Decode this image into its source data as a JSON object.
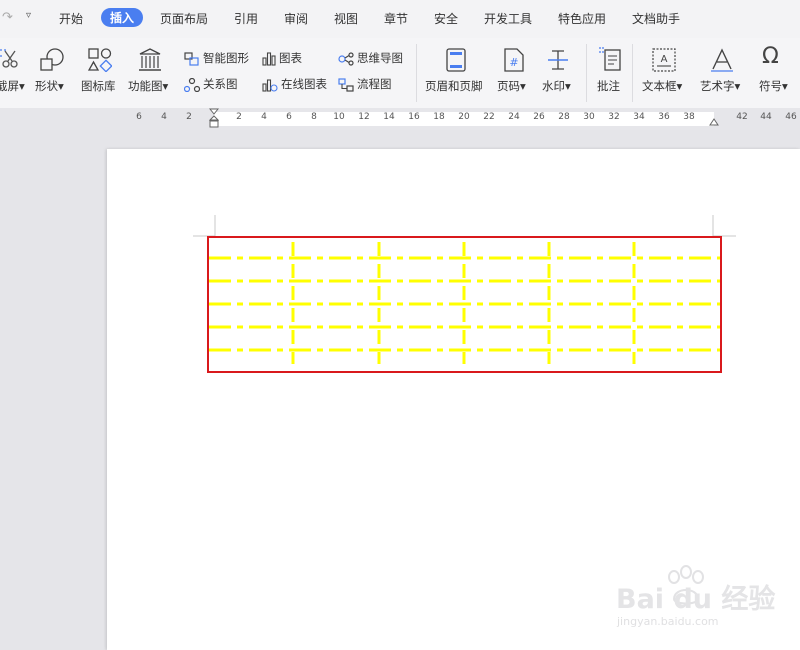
{
  "menu": {
    "items": [
      "开始",
      "插入",
      "页面布局",
      "引用",
      "审阅",
      "视图",
      "章节",
      "安全",
      "开发工具",
      "特色应用",
      "文档助手"
    ],
    "active_index": 1
  },
  "toolbar": {
    "screenshot_label": "截屏",
    "shape_label": "形状",
    "iconlib_label": "图标库",
    "function_label": "功能图",
    "smartart_label": "智能图形",
    "chart_label": "图表",
    "mindmap_label": "思维导图",
    "relation_label": "关系图",
    "onlinechart_label": "在线图表",
    "flowchart_label": "流程图",
    "header_footer_label": "页眉和页脚",
    "page_number_label": "页码",
    "watermark_label": "水印",
    "comment_label": "批注",
    "textbox_label": "文本框",
    "wordart_label": "艺术字",
    "symbol_label": "符号"
  },
  "ruler": {
    "ticks": [
      "6",
      "4",
      "2",
      "2",
      "4",
      "6",
      "8",
      "10",
      "12",
      "14",
      "16",
      "18",
      "20",
      "22",
      "24",
      "26",
      "28",
      "30",
      "32",
      "34",
      "36",
      "38",
      "42",
      "44",
      "46"
    ]
  },
  "watermark": {
    "logo_text": "Bai du 经验",
    "url": "jingyan.baidu.com"
  },
  "colors": {
    "accent": "#4a7ef0",
    "selection_border": "#d9191c",
    "table_lines": "#ffff00"
  }
}
